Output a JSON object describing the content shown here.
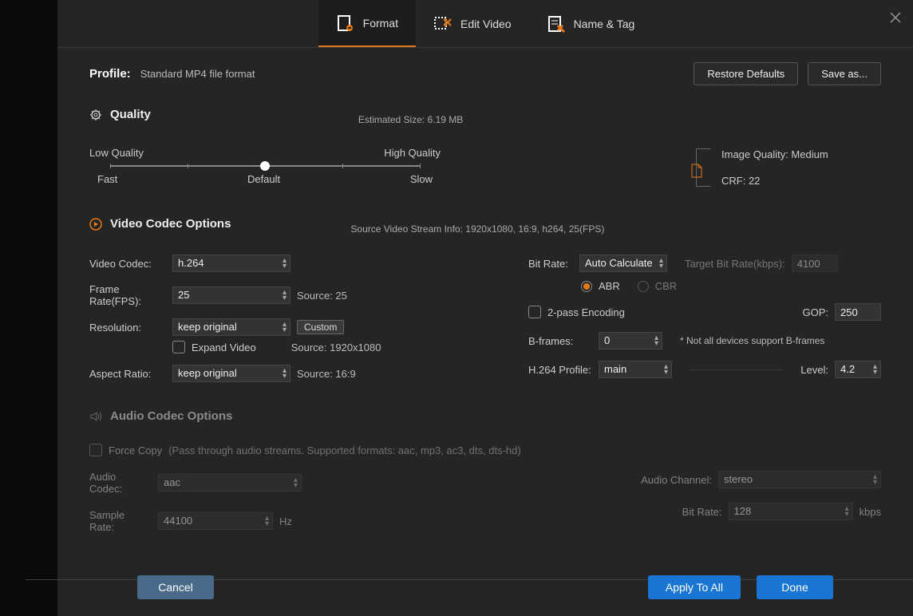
{
  "tabs": {
    "format": "Format",
    "edit": "Edit Video",
    "name": "Name & Tag"
  },
  "close": "✕",
  "profile": {
    "label": "Profile:",
    "value": "Standard MP4 file format"
  },
  "buttons": {
    "restore": "Restore Defaults",
    "saveas": "Save as..."
  },
  "quality": {
    "title": "Quality",
    "estimated": "Estimated Size: 6.19 MB",
    "low": "Low Quality",
    "high": "High Quality",
    "fast": "Fast",
    "default": "Default",
    "slow": "Slow",
    "image_quality": "Image Quality: Medium",
    "crf": "CRF: 22"
  },
  "video": {
    "title": "Video Codec Options",
    "source_info": "Source Video Stream Info: 1920x1080, 16:9, h264, 25(FPS)",
    "codec_label": "Video Codec:",
    "codec": "h.264",
    "fps_label": "Frame Rate(FPS):",
    "fps": "25",
    "fps_src": "Source: 25",
    "res_label": "Resolution:",
    "res": "keep original",
    "custom": "Custom",
    "expand": "Expand Video",
    "res_src": "Source: 1920x1080",
    "aspect_label": "Aspect Ratio:",
    "aspect": "keep original",
    "aspect_src": "Source: 16:9",
    "bitrate_label": "Bit Rate:",
    "bitrate": "Auto Calculate",
    "target_label": "Target Bit Rate(kbps):",
    "target": "4100",
    "abr": "ABR",
    "cbr": "CBR",
    "twopass": "2-pass Encoding",
    "gop_label": "GOP:",
    "gop": "250",
    "bframes_label": "B-frames:",
    "bframes": "0",
    "bframes_note": "* Not all devices support B-frames",
    "profile_label": "H.264 Profile:",
    "profile": "main",
    "level_label": "Level:",
    "level": "4.2"
  },
  "audio": {
    "title": "Audio Codec Options",
    "force": "Force Copy",
    "force_note": "(Pass through audio streams. Supported formats: aac, mp3, ac3, dts, dts-hd)",
    "codec_label": "Audio Codec:",
    "codec": "aac",
    "sample_label": "Sample Rate:",
    "sample": "44100",
    "hz": "Hz",
    "channel_label": "Audio Channel:",
    "channel": "stereo",
    "bitrate_label": "Bit Rate:",
    "bitrate": "128",
    "kbps": "kbps"
  },
  "footer": {
    "cancel": "Cancel",
    "apply": "Apply To All",
    "done": "Done"
  }
}
